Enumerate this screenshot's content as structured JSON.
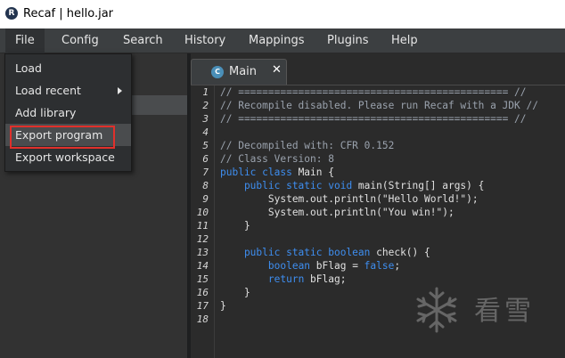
{
  "window": {
    "title": "Recaf | hello.jar",
    "app_icon_glyph": "R"
  },
  "menubar": [
    "File",
    "Config",
    "Search",
    "History",
    "Mappings",
    "Plugins",
    "Help"
  ],
  "file_menu": {
    "items": [
      "Load",
      "Load recent",
      "Add library",
      "Export program",
      "Export workspace"
    ],
    "highlighted": "Export program"
  },
  "editor": {
    "tab": {
      "label": "Main",
      "icon_glyph": "C",
      "close_glyph": "✕"
    },
    "line_numbers": [
      "1",
      "2",
      "3",
      "4",
      "5",
      "6",
      "7",
      "8",
      "9",
      "10",
      "11",
      "12",
      "13",
      "14",
      "15",
      "16",
      "17",
      "18"
    ],
    "code": [
      [
        {
          "t": "// ============================================= //",
          "c": "cm"
        }
      ],
      [
        {
          "t": "// Recompile disabled. Please run Recaf with a JDK //",
          "c": "cm"
        }
      ],
      [
        {
          "t": "// ============================================= //",
          "c": "cm"
        }
      ],
      [],
      [
        {
          "t": "// Decompiled with: CFR 0.152",
          "c": "cm"
        }
      ],
      [
        {
          "t": "// Class Version: 8",
          "c": "cm"
        }
      ],
      [
        {
          "t": "public class ",
          "c": "kw"
        },
        {
          "t": "Main {",
          "c": "tx"
        }
      ],
      [
        {
          "t": "    public static void ",
          "c": "kw"
        },
        {
          "t": "main(String[] args) {",
          "c": "tx"
        }
      ],
      [
        {
          "t": "        System.out.println(\"Hello World!\");",
          "c": "tx"
        }
      ],
      [
        {
          "t": "        System.out.println(\"You win!\");",
          "c": "tx"
        }
      ],
      [
        {
          "t": "    }",
          "c": "tx"
        }
      ],
      [],
      [
        {
          "t": "    public static boolean ",
          "c": "kw"
        },
        {
          "t": "check() {",
          "c": "tx"
        }
      ],
      [
        {
          "t": "        ",
          "c": "tx"
        },
        {
          "t": "boolean ",
          "c": "kw"
        },
        {
          "t": "bFlag = ",
          "c": "tx"
        },
        {
          "t": "false",
          "c": "kw"
        },
        {
          "t": ";",
          "c": "tx"
        }
      ],
      [
        {
          "t": "        ",
          "c": "tx"
        },
        {
          "t": "return ",
          "c": "kw"
        },
        {
          "t": "bFlag;",
          "c": "tx"
        }
      ],
      [
        {
          "t": "    }",
          "c": "tx"
        }
      ],
      [
        {
          "t": "}",
          "c": "tx"
        }
      ],
      []
    ]
  },
  "watermark": {
    "text": "看雪",
    "icon": "snowflake-icon"
  },
  "colors": {
    "highlight_border": "#e0302b",
    "keyword": "#3e8ef0",
    "comment": "#9aa2ad",
    "menubar": "#3c3f41"
  }
}
